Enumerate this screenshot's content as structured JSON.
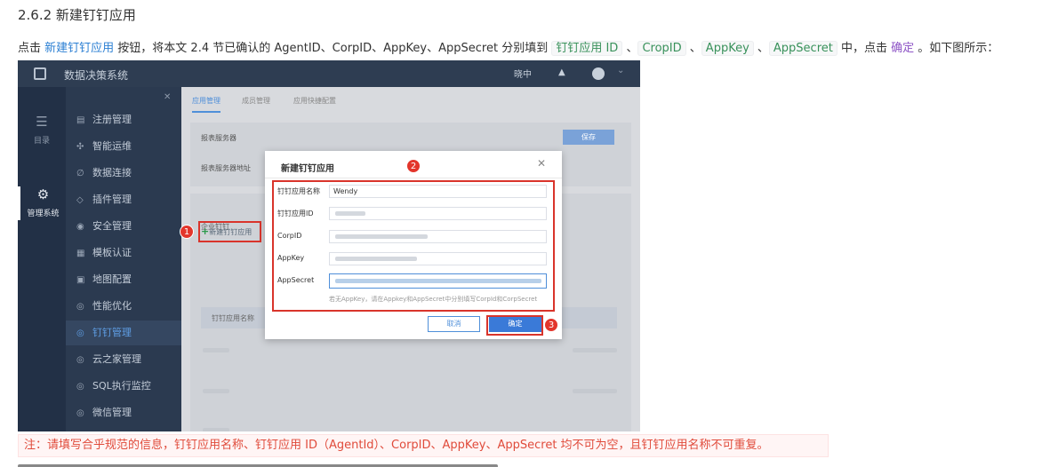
{
  "heading": "2.6.2 新建钉钉应用",
  "instruction": {
    "p1": "点击 ",
    "link": "新建钉钉应用",
    "p2": " 按钮，将本文 2.4 节已确认的 AgentID、CorpID、AppKey、AppSecret 分别填到 ",
    "c1": "钉钉应用 ID",
    "s1": " 、",
    "c2": "CropID",
    "s2": " 、",
    "c3": "AppKey",
    "s3": " 、",
    "c4": "AppSecret",
    "p3": " 中，点击 ",
    "ok": "确定",
    "p4": " 。如下图所示："
  },
  "screenshot": {
    "topbar": {
      "title": "数据决策系统",
      "user": "晓中"
    },
    "rail": [
      {
        "label": "目录",
        "icon": "list-icon"
      },
      {
        "label": "管理系统",
        "icon": "gear-icon"
      }
    ],
    "sidebar": [
      {
        "label": "注册管理",
        "icon": "register-icon"
      },
      {
        "label": "智能运维",
        "icon": "ops-icon"
      },
      {
        "label": "数据连接",
        "icon": "link-icon"
      },
      {
        "label": "插件管理",
        "icon": "plugin-icon"
      },
      {
        "label": "安全管理",
        "icon": "shield-icon"
      },
      {
        "label": "模板认证",
        "icon": "template-icon"
      },
      {
        "label": "地图配置",
        "icon": "map-icon"
      },
      {
        "label": "性能优化",
        "icon": "performance-icon"
      },
      {
        "label": "钉钉管理",
        "icon": "dingtalk-icon",
        "active": true
      },
      {
        "label": "云之家管理",
        "icon": "cloud-icon"
      },
      {
        "label": "SQL执行监控",
        "icon": "monitor-icon"
      },
      {
        "label": "微信管理",
        "icon": "wechat-icon"
      }
    ],
    "tabs": [
      "应用管理",
      "成员管理",
      "应用快捷配置"
    ],
    "server_section": "报表服务器",
    "server_addr_label": "报表服务器地址",
    "save": "保存",
    "enterprise_section": "企业钉钉",
    "new_app": "新建钉钉应用",
    "table_header": "钉钉应用名称",
    "dialog": {
      "title": "新建钉钉应用",
      "fields": [
        {
          "label": "钉钉应用名称",
          "value": "Wendy"
        },
        {
          "label": "钉钉应用ID",
          "value": ""
        },
        {
          "label": "CorpID",
          "value": ""
        },
        {
          "label": "AppKey",
          "value": ""
        },
        {
          "label": "AppSecret",
          "value": ""
        }
      ],
      "hint": "若无AppKey，请在Appkey和AppSecret中分别填写CorpId和CorpSecret",
      "cancel": "取消",
      "confirm": "确定"
    },
    "markers": [
      "1",
      "2",
      "3"
    ]
  },
  "note": "注：请填写合乎规范的信息，钉钉应用名称、钉钉应用 ID（AgentId）、CorpID、AppKey、AppSecret 均不可为空，且钉钉应用名称不可重复。",
  "colors": {
    "link": "#2b7fd3",
    "code": "#38915a",
    "highlight": "#d9342b",
    "note": "#e04b3b"
  }
}
